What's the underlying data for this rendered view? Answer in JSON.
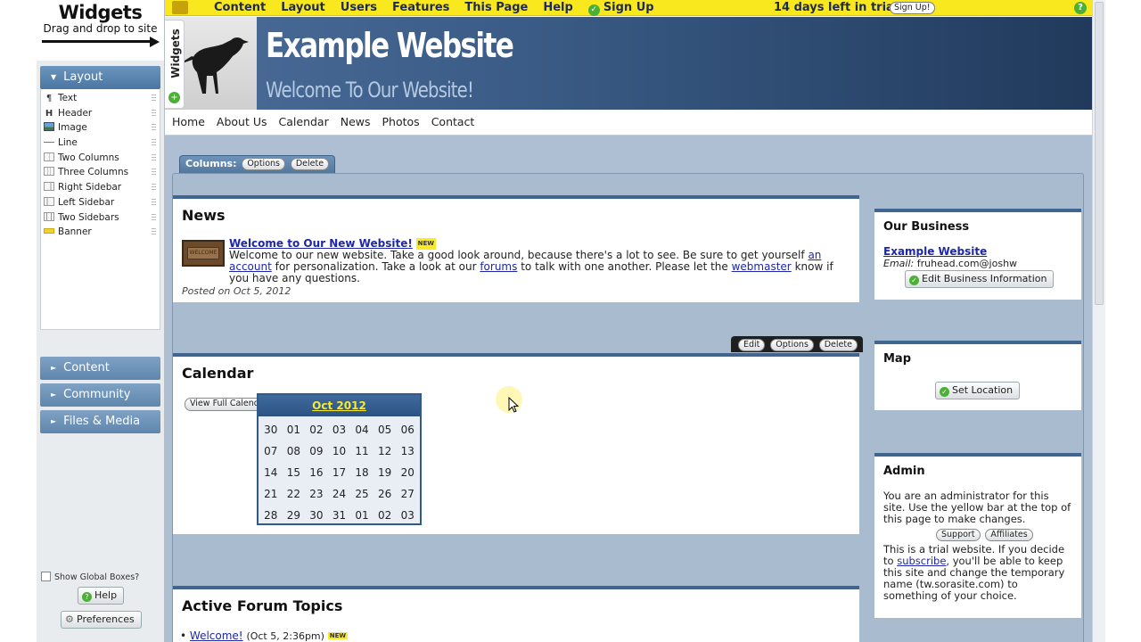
{
  "widgets_panel": {
    "title": "Widgets",
    "subtitle": "Drag and drop to site",
    "layout_label": "Layout",
    "layout_items": [
      {
        "label": "Text",
        "icon": "paragraph-icon"
      },
      {
        "label": "Header",
        "icon": "header-icon"
      },
      {
        "label": "Image",
        "icon": "image-icon"
      },
      {
        "label": "Line",
        "icon": "line-icon"
      },
      {
        "label": "Two Columns",
        "icon": "two-columns-icon"
      },
      {
        "label": "Three Columns",
        "icon": "three-columns-icon"
      },
      {
        "label": "Right Sidebar",
        "icon": "right-sidebar-icon"
      },
      {
        "label": "Left Sidebar",
        "icon": "left-sidebar-icon"
      },
      {
        "label": "Two Sidebars",
        "icon": "two-sidebars-icon"
      },
      {
        "label": "Banner",
        "icon": "banner-icon"
      }
    ],
    "categories": [
      "Content",
      "Community",
      "Files & Media"
    ],
    "show_global_boxes": "Show Global Boxes?",
    "help_label": "Help",
    "preferences_label": "Preferences"
  },
  "topbar": {
    "menu": [
      "Content",
      "Layout",
      "Users",
      "Features",
      "This Page",
      "Help"
    ],
    "signup": "Sign Up",
    "trial_text": "14 days left in trial",
    "signup_button": "Sign Up!"
  },
  "header": {
    "title": "Example Website",
    "subtitle": "Welcome To Our Website!",
    "widgets_tab": "Widgets"
  },
  "nav": [
    "Home",
    "About Us",
    "Calendar",
    "News",
    "Photos",
    "Contact"
  ],
  "columns_bar": {
    "label": "Columns:",
    "options": "Options",
    "delete": "Delete"
  },
  "news": {
    "title": "News",
    "item_title": "Welcome to Our New Website!",
    "badge": "NEW",
    "text_1": "Welcome to our new website. Take a good look around, because there's a lot to see. Be sure to get yourself",
    "link_account": "an account",
    "text_2": "for personalization. Take a look at our",
    "link_forums": "forums",
    "text_3": "to talk with one another. Please let the",
    "link_webmaster": "webmaster",
    "text_4": "know if you have any questions.",
    "posted": "Posted on Oct 5, 2012",
    "mat_text": "WELCOME"
  },
  "edit_bar": {
    "edit": "Edit",
    "options": "Options",
    "delete": "Delete"
  },
  "calendar": {
    "title": "Calendar",
    "view_full": "View Full Calendar",
    "month": "Oct 2012",
    "days": [
      "30",
      "01",
      "02",
      "03",
      "04",
      "05",
      "06",
      "07",
      "08",
      "09",
      "10",
      "11",
      "12",
      "13",
      "14",
      "15",
      "16",
      "17",
      "18",
      "19",
      "20",
      "21",
      "22",
      "23",
      "24",
      "25",
      "26",
      "27",
      "28",
      "29",
      "30",
      "31",
      "01",
      "02",
      "03"
    ]
  },
  "forum": {
    "title": "Active Forum Topics",
    "topic": "Welcome!",
    "topic_meta": "(Oct 5, 2:36pm)",
    "badge": "NEW"
  },
  "our_business": {
    "title": "Our Business",
    "name": "Example Website",
    "email_label": "Email:",
    "email": "fruhead.com@joshw",
    "edit_button": "Edit Business Information"
  },
  "map": {
    "title": "Map",
    "button": "Set Location"
  },
  "admin": {
    "title": "Admin",
    "text": "You are an administrator for this site. Use the yellow bar at the top of this page to make changes.",
    "support": "Support",
    "affiliates": "Affiliates",
    "trial_1": "This is a trial website. If you decide to",
    "subscribe": "subscribe",
    "trial_2": ", you'll be able to keep this site and change the temporary name (tw.sorasite.com) to something of your choice."
  },
  "colors": {
    "topbar": "#fae81e",
    "header": "#3a5b85",
    "accent": "#3f6590",
    "link": "#1d27a8"
  }
}
